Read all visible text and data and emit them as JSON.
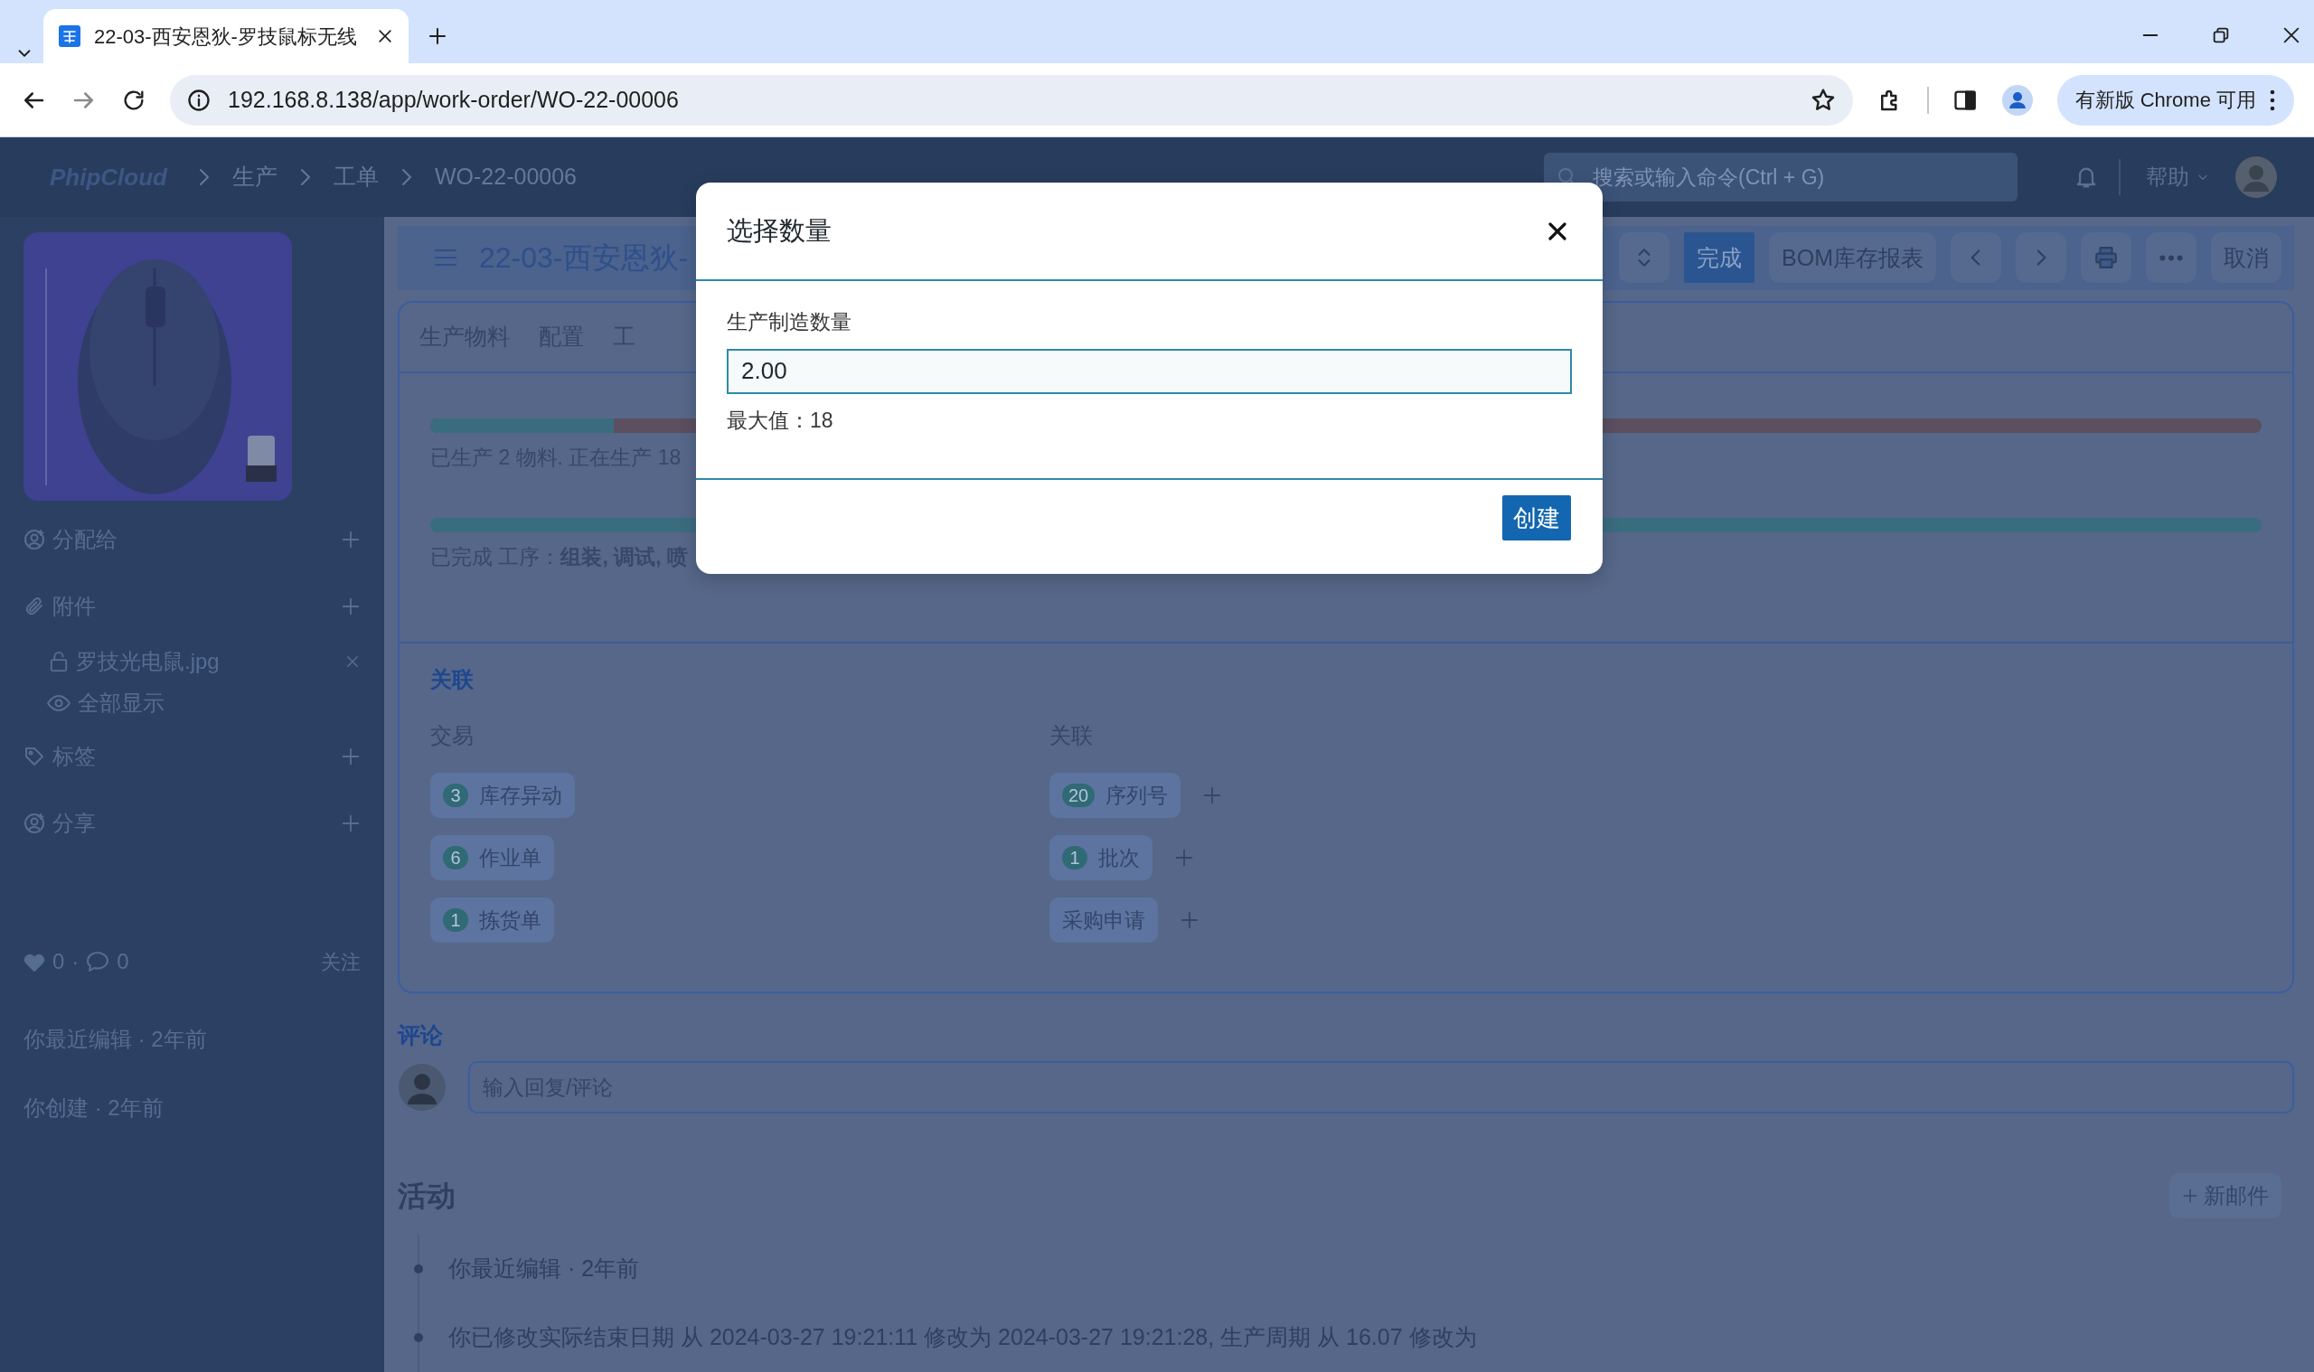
{
  "browser": {
    "tab_title": "22-03-西安恩狄-罗技鼠标无线",
    "url": "192.168.8.138/app/work-order/WO-22-00006",
    "update_button": "有新版 Chrome 可用"
  },
  "header": {
    "logo": "PhipCloud",
    "breadcrumbs": [
      "生产",
      "工单",
      "WO-22-00006"
    ],
    "search": {
      "placeholder": "搜索或输入命令(Ctrl + G)"
    },
    "help": "帮助"
  },
  "sidebar": {
    "image": {
      "kind": "picture"
    },
    "sections": [
      {
        "kind": "assign",
        "label": "分配给"
      },
      {
        "kind": "attachments",
        "label": "附件",
        "items": [
          {
            "name": "罗技光电鼠.jpg"
          }
        ],
        "show_all": "全部显示"
      },
      {
        "kind": "tags",
        "label": "标签"
      },
      {
        "kind": "share",
        "label": "分享"
      }
    ],
    "likes": "0",
    "separator": "·",
    "comments": "0",
    "follow": "关注",
    "meta": [
      "你最近编辑 · 2年前",
      "你创建 · 2年前"
    ]
  },
  "page": {
    "title": "22-03-西安恩狄-",
    "actions": [
      {
        "kind": "select"
      },
      {
        "kind": "primary",
        "label": "完成"
      },
      {
        "kind": "default",
        "label": "BOM库存报表"
      },
      {
        "kind": "prev"
      },
      {
        "kind": "next"
      },
      {
        "kind": "print"
      },
      {
        "kind": "more"
      },
      {
        "kind": "default",
        "label": "取消"
      }
    ],
    "tabs": [
      {
        "label": "生产物料",
        "selected": false
      },
      {
        "label": "配置",
        "selected": false
      },
      {
        "label": "工",
        "selected": false
      }
    ],
    "progress": [
      {
        "level": 0.1,
        "text": "已生产 2 物料. 正在生产 18"
      },
      {
        "level": 1,
        "text": "已完成 工序：**组装, 调试, 喷**"
      }
    ],
    "connections": {
      "title": "关联",
      "columns": [
        {
          "heading": "交易",
          "items": [
            {
              "count": "3",
              "label": "库存异动",
              "addable": false
            },
            {
              "count": "6",
              "label": "作业单",
              "addable": false
            },
            {
              "count": "1",
              "label": "拣货单",
              "addable": false
            }
          ]
        },
        {
          "heading": "关联",
          "items": [
            {
              "count": "20",
              "label": "序列号",
              "addable": true
            },
            {
              "count": "1",
              "label": "批次",
              "addable": true
            },
            {
              "label": "采购申请",
              "addable": true
            }
          ]
        }
      ]
    },
    "comments": {
      "title": "评论",
      "placeholder": "输入回复/评论"
    },
    "activity": {
      "title": "活动",
      "new_email": "新邮件",
      "items": [
        "你最近编辑 · 2年前",
        "你已修改实际结束日期 从 2024-03-27 19:21:11 修改为 2024-03-27 19:21:28, 生产周期 从 16.07 修改为"
      ]
    }
  },
  "dialog": {
    "title": "选择数量",
    "field": {
      "label": "生产制造数量",
      "value": "2.00",
      "hint": "最大值：18"
    },
    "button": "创建"
  }
}
